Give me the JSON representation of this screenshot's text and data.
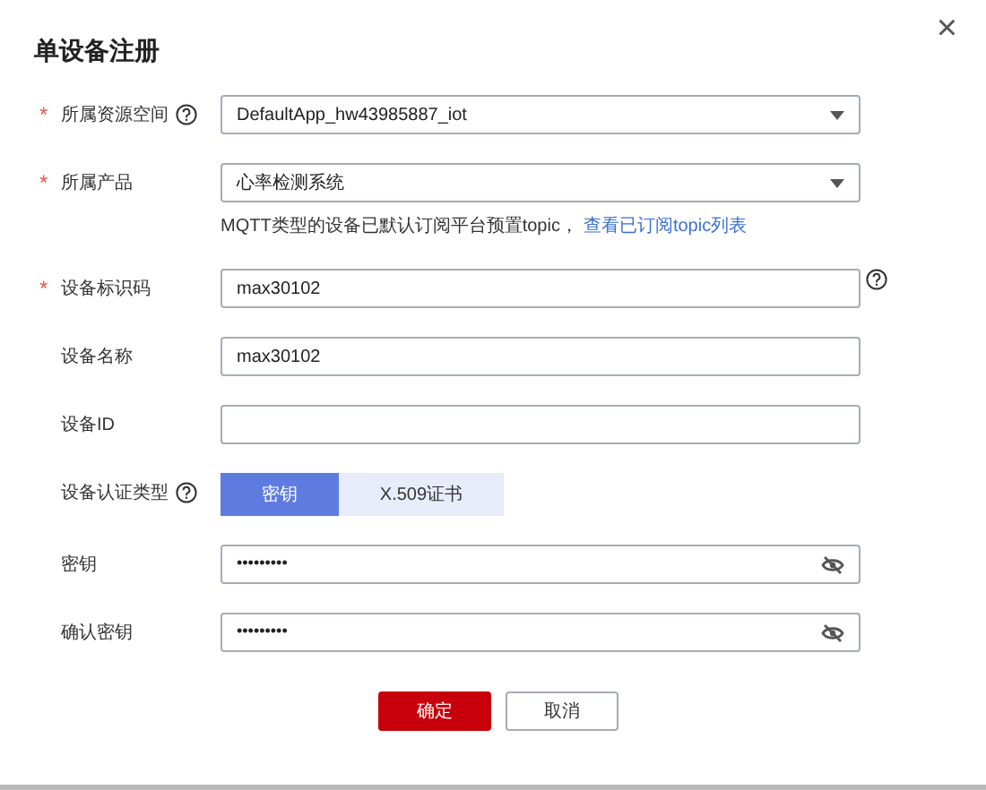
{
  "dialog": {
    "title": "单设备注册",
    "close": "×"
  },
  "rows": [
    {
      "kind": "select",
      "label": "所属资源空间",
      "required": "*",
      "help": true,
      "value": "DefaultApp_hw43985887_iot"
    },
    {
      "kind": "select",
      "label": "所属产品",
      "required": "*",
      "help": false,
      "value": "心率检测系统",
      "hint": "MQTT类型的设备已默认订阅平台预置topic，",
      "link": "查看已订阅topic列表"
    },
    {
      "kind": "text",
      "label": "设备标识码",
      "required": "*",
      "help": false,
      "field_help": true,
      "value": "max30102"
    },
    {
      "kind": "text",
      "label": "设备名称",
      "help": false,
      "value": "max30102"
    },
    {
      "kind": "text",
      "label": "设备ID",
      "help": false
    },
    {
      "kind": "toggle",
      "label": "设备认证类型",
      "help": true,
      "options": [
        {
          "label": "密钥",
          "selected": true
        },
        {
          "label": "X.509证书",
          "selected": false
        }
      ]
    },
    {
      "kind": "password",
      "label": "密钥",
      "help": false,
      "value": "•••••••••"
    },
    {
      "kind": "password",
      "label": "确认密钥",
      "help": false,
      "value": "•••••••••"
    }
  ],
  "buttons": [
    {
      "kind": "primary",
      "label": "确定"
    },
    {
      "kind": "secondary",
      "label": "取消"
    }
  ]
}
